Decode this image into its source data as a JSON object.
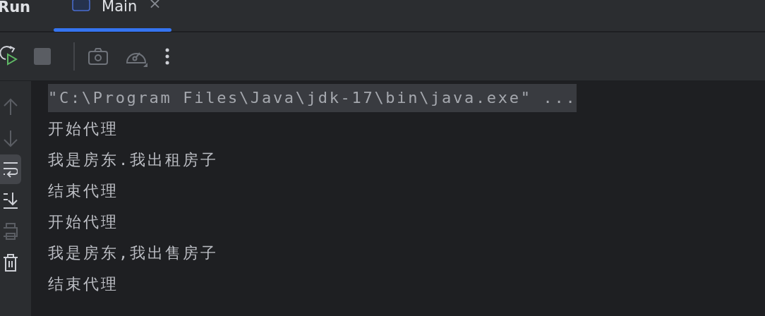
{
  "panel": {
    "title": "Run"
  },
  "tabs": [
    {
      "label": "Main",
      "selected": true,
      "close": "×"
    }
  ],
  "toolbar": [
    {
      "kind": "rerun"
    },
    {
      "kind": "stop"
    },
    {
      "kind": "snapshot"
    },
    {
      "kind": "profiler"
    },
    {
      "kind": "more"
    }
  ],
  "sidebar": [
    {
      "kind": "up",
      "selected": false
    },
    {
      "kind": "down",
      "selected": false
    },
    {
      "kind": "wrap",
      "selected": true
    },
    {
      "kind": "scroll",
      "selected": false
    },
    {
      "kind": "print",
      "selected": false
    },
    {
      "kind": "trash",
      "selected": false
    }
  ],
  "console": [
    {
      "text": "\"C:\\Program Files\\Java\\jdk-17\\bin\\java.exe\" ...",
      "kind": "command"
    },
    {
      "text": "开始代理",
      "kind": "output"
    },
    {
      "text": "我是房东.我出租房子",
      "kind": "output"
    },
    {
      "text": "结束代理",
      "kind": "output"
    },
    {
      "text": "开始代理",
      "kind": "output"
    },
    {
      "text": "我是房东,我出售房子",
      "kind": "output"
    },
    {
      "text": "结束代理",
      "kind": "output"
    }
  ]
}
